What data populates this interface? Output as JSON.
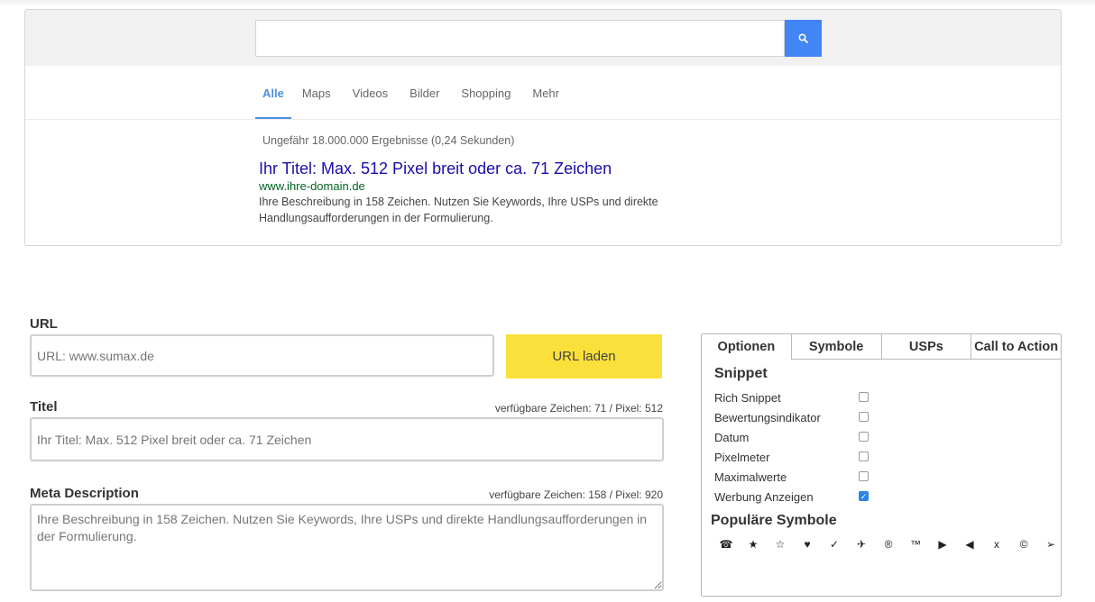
{
  "serp": {
    "search_value": "",
    "tabs": [
      "Alle",
      "Maps",
      "Videos",
      "Bilder",
      "Shopping",
      "Mehr"
    ],
    "results_count": "Ungefähr 18.000.000 Ergebnisse (0,24 Sekunden)",
    "result_title": "Ihr Titel: Max. 512 Pixel breit oder ca. 71 Zeichen",
    "result_url": "www.ihre-domain.de",
    "result_description": "Ihre Beschreibung in 158 Zeichen. Nutzen Sie Keywords, Ihre USPs und direkte Handlungsaufforderungen in der Formulierung."
  },
  "form": {
    "url_label": "URL",
    "url_placeholder": "URL: www.sumax.de",
    "url_value": "",
    "load_button": "URL laden",
    "title_label": "Titel",
    "title_counter": "verfügbare Zeichen: 71 / Pixel: 512",
    "title_placeholder": "Ihr Titel: Max. 512 Pixel breit oder ca. 71 Zeichen",
    "meta_label": "Meta Description",
    "meta_counter": "verfügbare Zeichen: 158 / Pixel: 920",
    "meta_placeholder": "Ihre Beschreibung in 158 Zeichen. Nutzen Sie Keywords, Ihre USPs und direkte Handlungsaufforderungen in der Formulierung."
  },
  "panel": {
    "tabs": [
      "Optionen",
      "Symbole",
      "USPs",
      "Call to Action"
    ],
    "active_tab": "Optionen",
    "snippet_heading": "Snippet",
    "options": [
      {
        "label": "Rich Snippet",
        "checked": false
      },
      {
        "label": "Bewertungsindikator",
        "checked": false
      },
      {
        "label": "Datum",
        "checked": false
      },
      {
        "label": "Pixelmeter",
        "checked": false
      },
      {
        "label": "Maximalwerte",
        "checked": false
      },
      {
        "label": "Werbung Anzeigen",
        "checked": true
      }
    ],
    "symbols_heading": "Populäre Symbole",
    "symbols": [
      "☎",
      "★",
      "☆",
      "♥",
      "✓",
      "✈",
      "®",
      "™",
      "▶",
      "◀",
      "x",
      "©",
      "➢"
    ]
  },
  "colors": {
    "accent_blue": "#4a90e2",
    "search_button": "#4285f4",
    "link_title": "#1a0dab",
    "link_url": "#006621",
    "load_button": "#fbe03b",
    "checkbox_checked": "#2b84e6"
  }
}
